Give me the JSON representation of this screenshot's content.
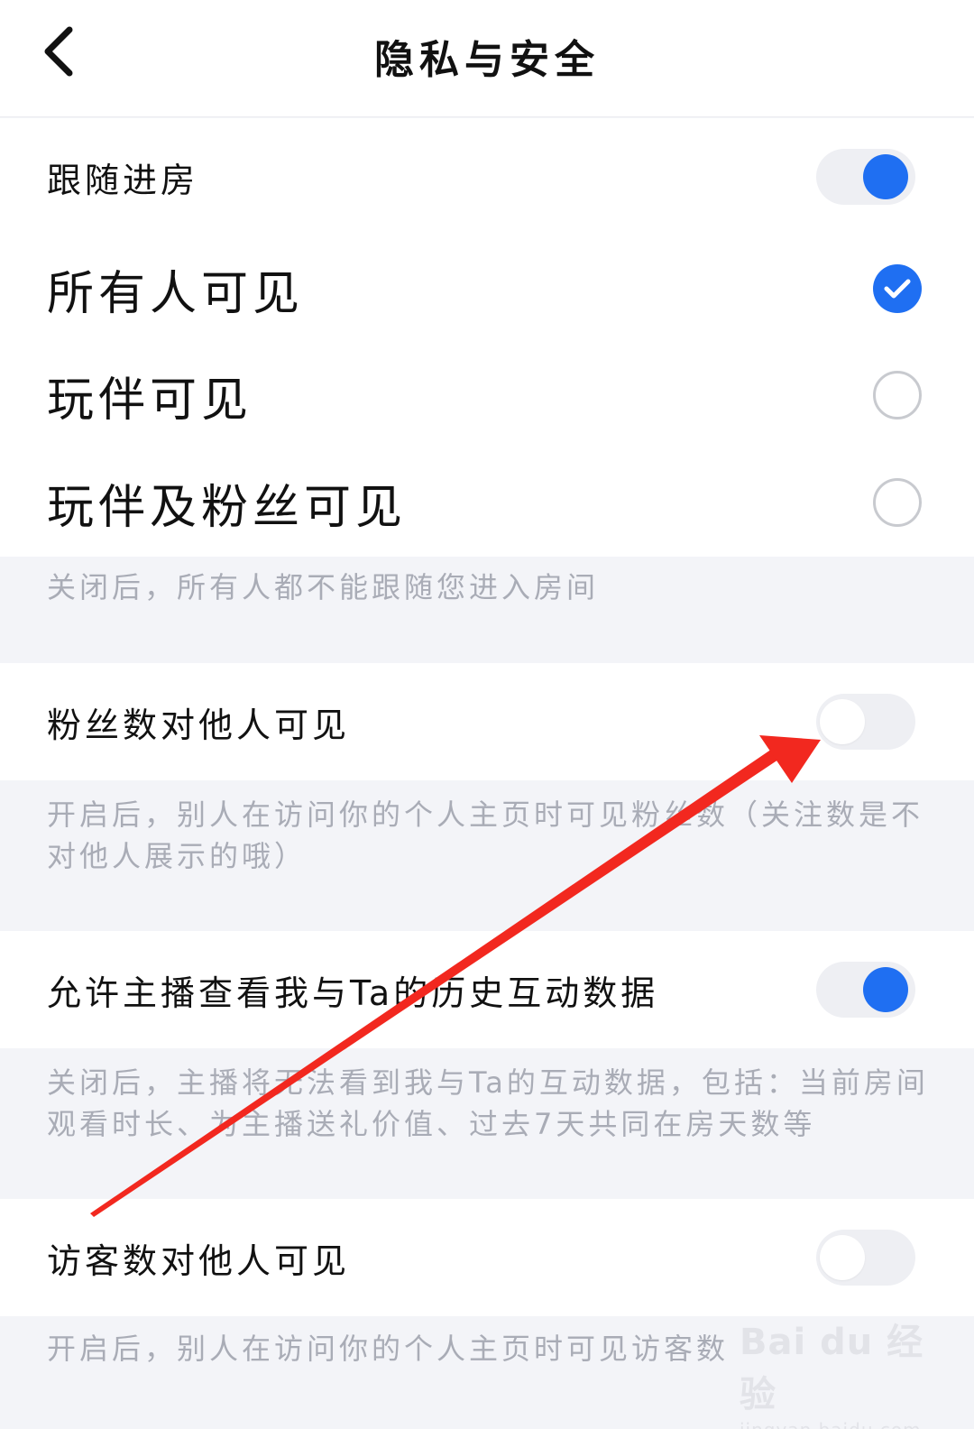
{
  "header": {
    "title": "隐私与安全",
    "back_icon": "chevron-left-icon"
  },
  "follow_room": {
    "label": "跟随进房",
    "toggle_on": true,
    "options": [
      {
        "label": "所有人可见",
        "selected": true
      },
      {
        "label": "玩伴可见",
        "selected": false
      },
      {
        "label": "玩伴及粉丝可见",
        "selected": false
      }
    ],
    "description": "关闭后，所有人都不能跟随您进入房间"
  },
  "fans_visible": {
    "label": "粉丝数对他人可见",
    "toggle_on": false,
    "description": "开启后，别人在访问你的个人主页时可见粉丝数（关注数是不对他人展示的哦）"
  },
  "history_data": {
    "label": "允许主播查看我与Ta的历史互动数据",
    "toggle_on": true,
    "description": "关闭后，主播将无法看到我与Ta的互动数据，包括：当前房间观看时长、为主播送礼价值、过去7天共同在房天数等"
  },
  "visitors_visible": {
    "label": "访客数对他人可见",
    "toggle_on": false,
    "description": "开启后，别人在访问你的个人主页时可见访客数"
  },
  "watermark": {
    "logo": "Bai du 经验",
    "url": "jingyan.baidu.com"
  },
  "colors": {
    "accent": "#1f6ff2",
    "annotation_arrow": "#f2281f",
    "section_bg": "#f3f4f8"
  }
}
